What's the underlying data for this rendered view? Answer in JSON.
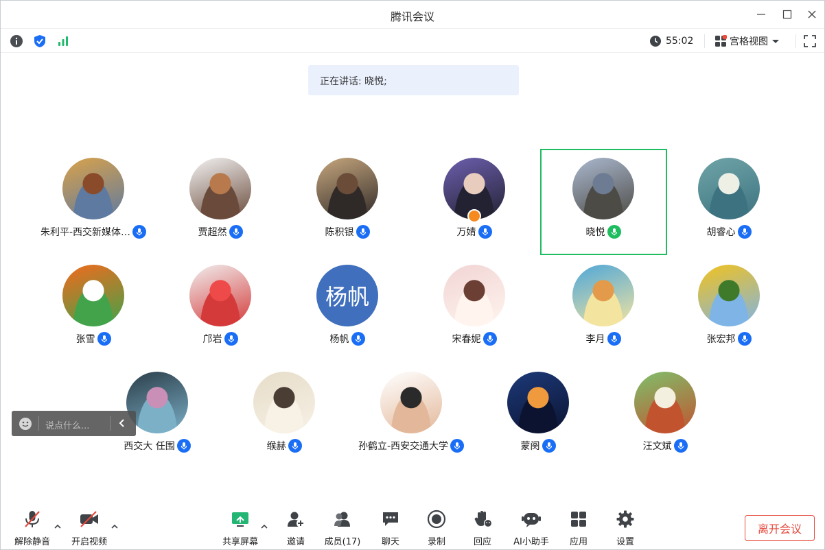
{
  "window": {
    "title": "腾讯会议"
  },
  "top_bar": {
    "timer": "55:02",
    "view_mode": "宫格视图"
  },
  "speaking_banner": {
    "text": "正在讲话: 晓悦;"
  },
  "participants": [
    {
      "name": "朱利平-西交新媒体…",
      "avatar": "photo",
      "colors": [
        "#d9a24a",
        "#8a4b2b",
        "#5f7aa0"
      ]
    },
    {
      "name": "贾超然",
      "avatar": "photo",
      "colors": [
        "#f3f3f3",
        "#b87a4c",
        "#6a4a3a"
      ]
    },
    {
      "name": "陈积银",
      "avatar": "photo",
      "colors": [
        "#c7a77e",
        "#6b4c38",
        "#2f2a28"
      ]
    },
    {
      "name": "万婧",
      "avatar": "photo",
      "colors": [
        "#6d5fae",
        "#e8cdbf",
        "#222233"
      ]
    },
    {
      "name": "晓悦",
      "avatar": "photo",
      "colors": [
        "#aab8cf",
        "#6d7c92",
        "#4d4b45"
      ]
    },
    {
      "name": "胡睿心",
      "avatar": "photo",
      "colors": [
        "#6fa5a8",
        "#eef0e6",
        "#3d7280"
      ]
    },
    {
      "name": "张雪",
      "avatar": "photo",
      "colors": [
        "#f26a1d",
        "#ffffff",
        "#42a34a"
      ]
    },
    {
      "name": "邝岩",
      "avatar": "photo",
      "colors": [
        "#f1eeee",
        "#ef4a4a",
        "#d43a3a"
      ]
    },
    {
      "name": "杨帆",
      "avatar": "text",
      "text": "杨帆",
      "colors": [
        "#3f6fbd"
      ]
    },
    {
      "name": "宋春妮",
      "avatar": "photo",
      "colors": [
        "#f1d5d5",
        "#6b3f33",
        "#fff4ee"
      ]
    },
    {
      "name": "李月",
      "avatar": "photo",
      "colors": [
        "#4fa7d9",
        "#e39a4a",
        "#f3e4a0"
      ]
    },
    {
      "name": "张宏邦",
      "avatar": "photo",
      "colors": [
        "#f2c21d",
        "#3f7a2a",
        "#7eb4e6"
      ]
    },
    {
      "name": "西交大 任围",
      "avatar": "photo",
      "colors": [
        "#2b3d49",
        "#c98fb7",
        "#7bb0c7"
      ]
    },
    {
      "name": "缑赫",
      "avatar": "photo",
      "colors": [
        "#e6dcc8",
        "#4a3d33",
        "#f7f1e6"
      ]
    },
    {
      "name": "孙鹤立-西安交通大学",
      "avatar": "photo",
      "colors": [
        "#ffffff",
        "#2a2a2a",
        "#e3b89a"
      ]
    },
    {
      "name": "蒙阕",
      "avatar": "photo",
      "colors": [
        "#1d3a7a",
        "#f09a3e",
        "#0b1330"
      ]
    },
    {
      "name": "汪文斌",
      "avatar": "photo",
      "colors": [
        "#7ec06b",
        "#f3f0e0",
        "#c2532f"
      ]
    }
  ],
  "chat": {
    "placeholder": "说点什么..."
  },
  "bottom_bar": {
    "unmute": "解除静音",
    "start_video": "开启视频",
    "share_screen": "共享屏幕",
    "invite": "邀请",
    "members": "成员(17)",
    "chat": "聊天",
    "record": "录制",
    "react": "回应",
    "ai_assistant": "AI小助手",
    "apps": "应用",
    "settings": "设置",
    "leave": "离开会议"
  },
  "colors": {
    "accent": "#1a6ef5",
    "active_speaker": "#1fbd5f",
    "leave": "#e5483b"
  }
}
